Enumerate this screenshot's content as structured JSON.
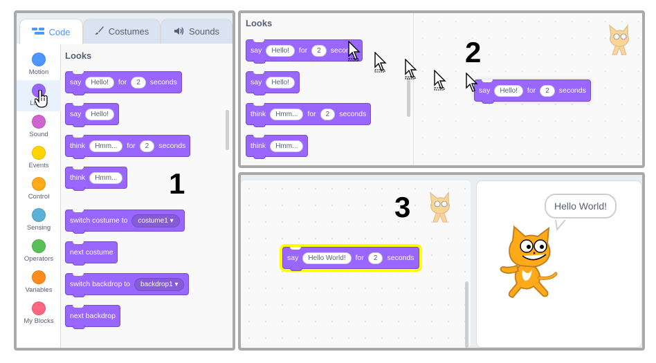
{
  "tabs": [
    {
      "label": "Code",
      "icon": "code-icon"
    },
    {
      "label": "Costumes",
      "icon": "brush-icon"
    },
    {
      "label": "Sounds",
      "icon": "speaker-icon"
    }
  ],
  "categories": [
    {
      "label": "Motion",
      "color": "#4c97ff"
    },
    {
      "label": "Looks",
      "color": "#9966ff"
    },
    {
      "label": "Sound",
      "color": "#cf63cf"
    },
    {
      "label": "Events",
      "color": "#ffd500"
    },
    {
      "label": "Control",
      "color": "#ffab19"
    },
    {
      "label": "Sensing",
      "color": "#5cb1d6"
    },
    {
      "label": "Operators",
      "color": "#59c059"
    },
    {
      "label": "Variables",
      "color": "#ff8c1a"
    },
    {
      "label": "My Blocks",
      "color": "#ff6680"
    }
  ],
  "palette": {
    "title": "Looks",
    "blocks": {
      "say_for": {
        "say": "say",
        "message": "Hello!",
        "for": "for",
        "secs": "2",
        "seconds": "seconds"
      },
      "say": {
        "say": "say",
        "message": "Hello!"
      },
      "think_for": {
        "think": "think",
        "message": "Hmm...",
        "for": "for",
        "secs": "2",
        "seconds": "seconds"
      },
      "think": {
        "think": "think",
        "message": "Hmm..."
      },
      "switch_costume": {
        "label": "switch costume to",
        "value": "costume1"
      },
      "next_costume": "next costume",
      "switch_backdrop": {
        "label": "switch backdrop to",
        "value": "backdrop1"
      },
      "next_backdrop": "next backdrop"
    }
  },
  "panel_numbers": [
    "1",
    "2",
    "3"
  ],
  "drag": {
    "title": "Looks",
    "dragged_block": {
      "say": "say",
      "message": "Hello!",
      "for": "for",
      "secs": "2",
      "seconds": "seconds"
    }
  },
  "script": {
    "block": {
      "say": "say",
      "message": "Hello World!",
      "for": "for",
      "secs": "2",
      "seconds": "seconds"
    },
    "highlight_color": "#ffff00"
  },
  "stage": {
    "speech": "Hello World!"
  },
  "colors": {
    "looks": "#9966ff",
    "looks_border": "#774dcb",
    "code_tab": "#4c97ff",
    "cat_orange": "#ffab19"
  }
}
